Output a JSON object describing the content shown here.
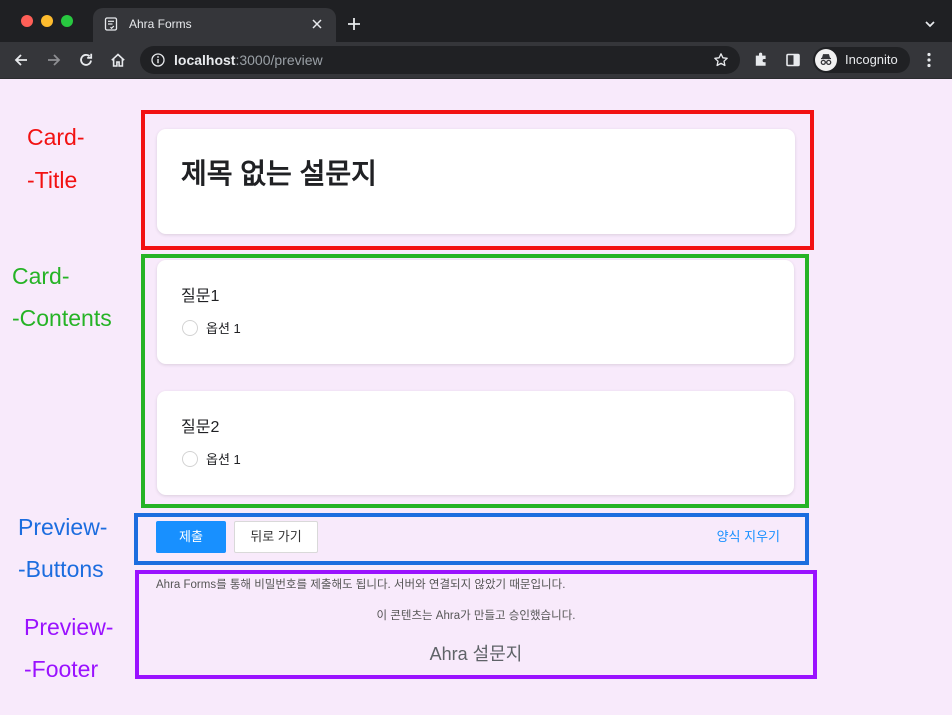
{
  "browser": {
    "tab_title": "Ahra Forms",
    "address_host": "localhost",
    "address_path": ":3000/preview",
    "profile_label": "Incognito",
    "icons": {
      "favicon": "form-document-icon",
      "tab_close": "close-icon",
      "new_tab": "plus-icon",
      "tab_search": "chevron-down-icon",
      "back": "back-arrow-icon",
      "forward": "forward-arrow-icon",
      "reload": "reload-icon",
      "home": "home-icon",
      "site_info": "info-icon",
      "bookmark": "star-icon",
      "extensions": "puzzle-icon",
      "side_panel": "side-panel-icon",
      "profile": "incognito-icon",
      "menu": "kebab-menu-icon"
    }
  },
  "annotations": {
    "card_title": {
      "line1": "Card-",
      "line2": "-Title",
      "color": "#f21212"
    },
    "card_contents": {
      "line1": "Card-",
      "line2": "-Contents",
      "color": "#26b326"
    },
    "preview_buttons": {
      "line1": "Preview-",
      "line2": "-Buttons",
      "color": "#1c6ddf"
    },
    "preview_footer": {
      "line1": "Preview-",
      "line2": "-Footer",
      "color": "#9a12ff"
    }
  },
  "form": {
    "title": "제목 없는 설문지",
    "questions": [
      {
        "label": "질문1",
        "options": [
          "옵션 1"
        ]
      },
      {
        "label": "질문2",
        "options": [
          "옵션 1"
        ]
      }
    ],
    "buttons": {
      "submit": "제출",
      "back": "뒤로 가기",
      "clear": "양식 지우기"
    },
    "footer": {
      "notice": "Ahra Forms를 통해 비밀번호를 제출해도 됩니다. 서버와 연결되지 않았기 때문입니다.",
      "disclaimer": "이 콘텐츠는 Ahra가 만들고 승인했습니다.",
      "brand": "Ahra 설문지"
    }
  },
  "theme": {
    "page_background": "#f8eafb",
    "accent": "#1890ff"
  }
}
